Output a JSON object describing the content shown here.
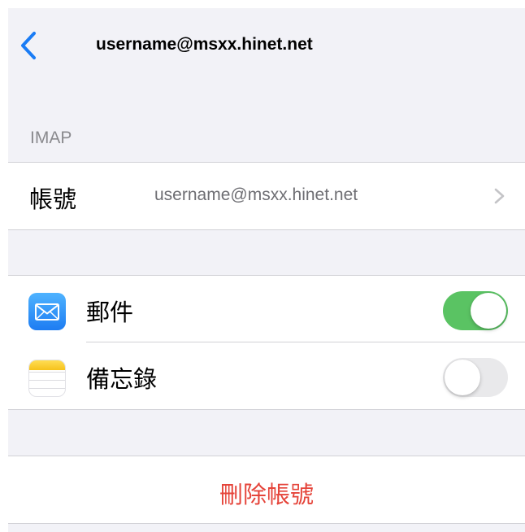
{
  "nav": {
    "title": "username@msxx.hinet.net"
  },
  "section": {
    "header": "IMAP"
  },
  "account_row": {
    "label": "帳號",
    "value": "username@msxx.hinet.net"
  },
  "toggles": [
    {
      "label": "郵件",
      "icon": "mail-icon",
      "on": true
    },
    {
      "label": "備忘錄",
      "icon": "notes-icon",
      "on": false
    }
  ],
  "delete_account": {
    "label": "刪除帳號"
  },
  "colors": {
    "accent": "#1a7cf5",
    "toggle_on": "#5ac363",
    "toggle_off": "#e9e9eb",
    "destructive": "#e5443a",
    "background": "#f2f2f7"
  }
}
